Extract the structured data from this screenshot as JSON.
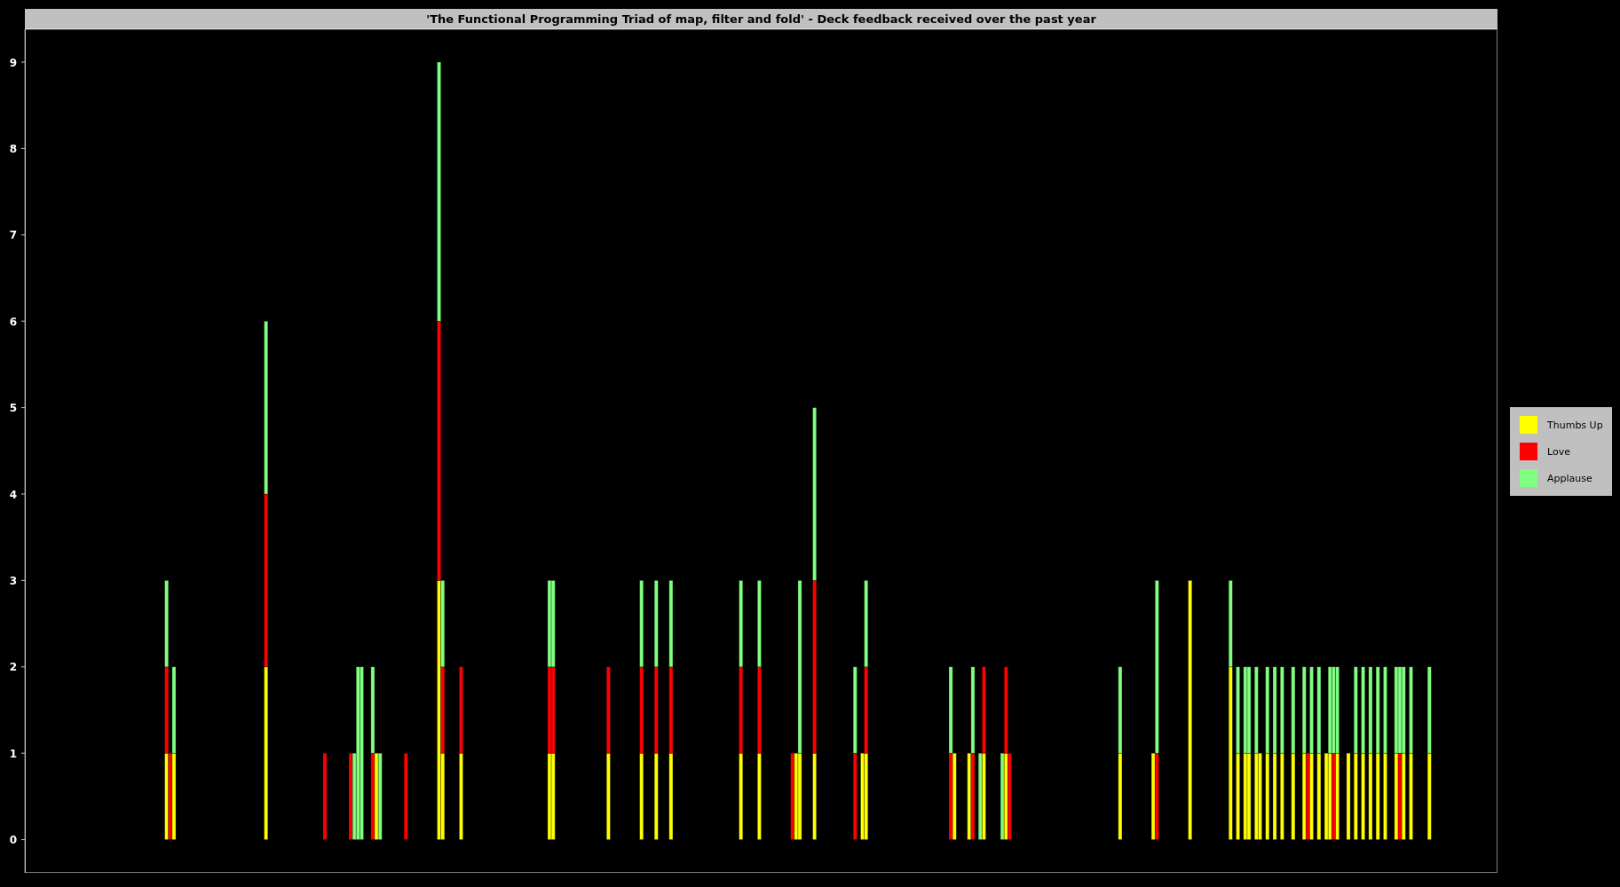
{
  "chart": {
    "title": "'The Functional Programming Triad of map, filter and fold' - Deck feedback received over the past year",
    "y_ticks": [
      "9",
      "8",
      "7",
      "6",
      "5",
      "4",
      "3",
      "2",
      "1",
      "0"
    ],
    "legend": [
      {
        "label": "Thumbs Up",
        "color": "#ffff00"
      },
      {
        "label": "Love",
        "color": "#ff0000"
      },
      {
        "label": "Applause",
        "color": "#80ff80"
      }
    ]
  }
}
